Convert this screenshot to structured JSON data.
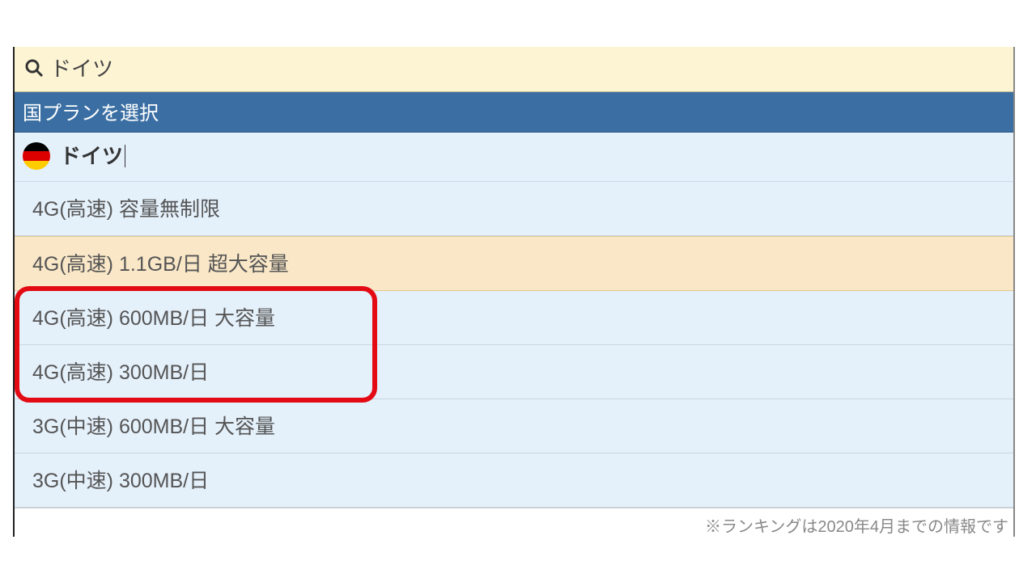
{
  "search": {
    "value": "ドイツ"
  },
  "section_header": "国プランを選択",
  "country": {
    "name": "ドイツ",
    "flag_colors": [
      "#000000",
      "#dd0000",
      "#ffcc00"
    ]
  },
  "plans": [
    {
      "label": "4G(高速) 容量無制限",
      "highlight": false
    },
    {
      "label": "4G(高速) 1.1GB/日 超大容量",
      "highlight": true
    },
    {
      "label": "4G(高速) 600MB/日 大容量",
      "highlight": false
    },
    {
      "label": "4G(高速) 300MB/日",
      "highlight": false
    },
    {
      "label": "3G(中速) 600MB/日 大容量",
      "highlight": false
    },
    {
      "label": "3G(中速) 300MB/日",
      "highlight": false
    }
  ],
  "annotation": {
    "red_box_plan_indices": [
      2,
      3
    ]
  },
  "footer_note": "※ランキングは2020年4月までの情報です"
}
